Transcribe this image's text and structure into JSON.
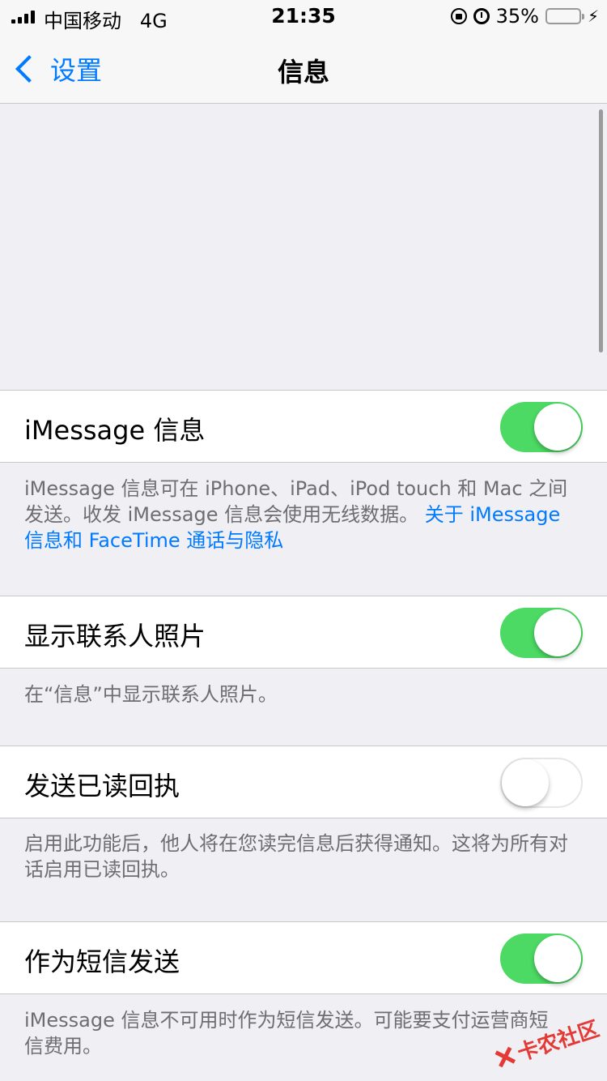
{
  "status_bar": {
    "carrier": "中国移动",
    "network": "4G",
    "time": "21:35",
    "battery_percent": "35%",
    "battery_level": 0.35,
    "battery_color": "#4cd964"
  },
  "nav": {
    "back_label": "设置",
    "title": "信息"
  },
  "settings": [
    {
      "label": "iMessage 信息",
      "toggle": true,
      "footer": "iMessage 信息可在 iPhone、iPad、iPod touch 和 Mac 之间发送。收发 iMessage 信息会使用无线数据。 ",
      "footer_link": "关于 iMessage 信息和 FaceTime 通话与隐私"
    },
    {
      "label": "显示联系人照片",
      "toggle": true,
      "footer": "在“信息”中显示联系人照片。"
    },
    {
      "label": "发送已读回执",
      "toggle": false,
      "footer": "启用此功能后，他人将在您读完信息后获得通知。这将为所有对话启用已读回执。"
    },
    {
      "label": "作为短信发送",
      "toggle": true,
      "footer": "iMessage 信息不可用时作为短信发送。可能要支付运营商短信费用。"
    }
  ],
  "watermark": "卡农社区",
  "colors": {
    "accent": "#007aff",
    "toggle_on": "#4cd964",
    "background": "#efeff4"
  }
}
